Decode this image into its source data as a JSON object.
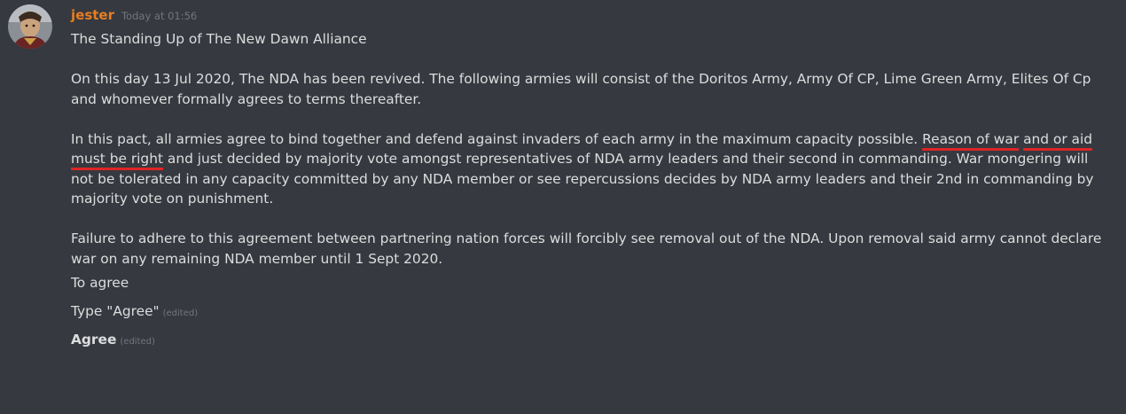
{
  "message": {
    "author": "jester",
    "timestamp": "Today at 01:56",
    "avatar_icon": "avatar-portrait",
    "title": "The Standing Up of The New Dawn Alliance",
    "para1": "On this day 13 Jul 2020, The NDA has been revived. The following armies will consist of the Doritos Army, Army Of CP, Lime Green Army, Elites Of Cp and whomever formally agrees to terms thereafter.",
    "para2_before": "In this pact, all armies agree to bind together and defend against invaders of each army in the maximum capacity possible. ",
    "para2_highlight1": "Reason of war",
    "para2_space": " ",
    "para2_highlight2": "and or aid must be right",
    "para2_after": " and just decided by majority vote amongst representatives of NDA army leaders and their second in commanding. War mongering will not be tolerated in any capacity committed by any NDA member or see repercussions decides by NDA army leaders and their 2nd in commanding by majority vote on punishment.",
    "para3": "Failure to adhere to this agreement between partnering nation forces will forcibly see removal out of the NDA. Upon removal said army cannot declare war on any remaining NDA member until 1 Sept 2020.",
    "to_agree": "To agree",
    "type_agree": "Type \"Agree\"",
    "edited_label": "(edited)",
    "agree_reply": "Agree",
    "highlight_color": "#e02424",
    "author_color": "#e67e22"
  }
}
